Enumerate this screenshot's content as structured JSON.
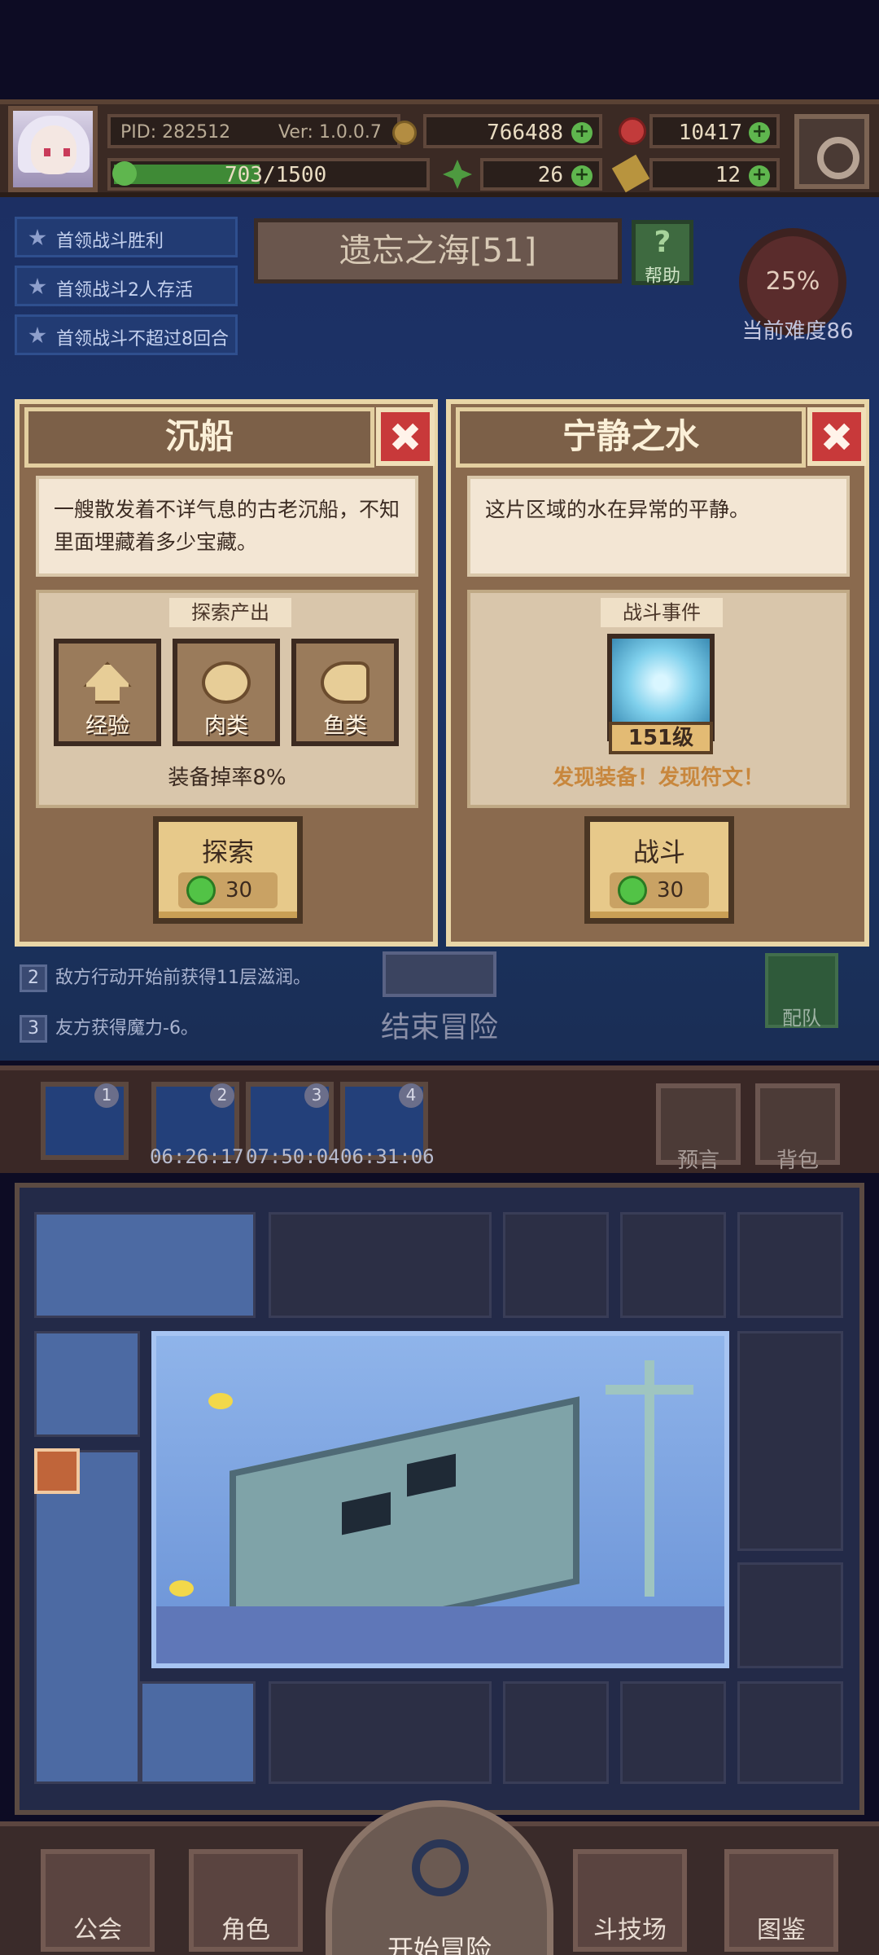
{
  "header": {
    "pid": "PID: 282512",
    "version": "Ver: 1.0.0.7",
    "gold": "766488",
    "gems": "10417",
    "xp_text": "703/1500",
    "xp_progress": 0.47,
    "clover": "26",
    "hammer": "12"
  },
  "quests": [
    {
      "label": "首领战斗胜利"
    },
    {
      "label": "首领战斗2人存活"
    },
    {
      "label": "首领战斗不超过8回合"
    }
  ],
  "zone": {
    "title": "遗忘之海[51]",
    "help": "帮助",
    "help_glyph": "?",
    "difficulty_pct": "25%",
    "difficulty_label": "当前难度86"
  },
  "cards": {
    "left": {
      "title": "沉船",
      "desc": "一艘散发着不详气息的古老沉船，不知里面埋藏着多少宝藏。",
      "panel_title": "探索产出",
      "outputs": [
        {
          "label": "经验"
        },
        {
          "label": "肉类"
        },
        {
          "label": "鱼类"
        }
      ],
      "drop_rate": "装备掉率8%",
      "button": {
        "label": "探索",
        "cost": "30"
      }
    },
    "right": {
      "title": "宁静之水",
      "desc": "这片区域的水在异常的平静。",
      "panel_title": "战斗事件",
      "monster_level": "151级",
      "event_text": "发现装备！发现符文！",
      "button": {
        "label": "战斗",
        "cost": "30"
      }
    }
  },
  "rules": [
    {
      "num": "2",
      "text": "敌方行动开始前获得11层滋润。"
    },
    {
      "num": "3",
      "text": "友方获得魔力-6。"
    }
  ],
  "end_adventure": "结束冒险",
  "team": "配队",
  "slots": [
    {
      "num": "1",
      "timer": ""
    },
    {
      "num": "2",
      "timer": "06:26:17"
    },
    {
      "num": "3",
      "timer": "07:50:04"
    },
    {
      "num": "4",
      "timer": "06:31:06"
    }
  ],
  "side_buttons": {
    "prophecy": "预言",
    "bag": "背包"
  },
  "nav": {
    "guild": "公会",
    "character": "角色",
    "start": "开始冒险",
    "arena": "斗技场",
    "codex": "图鉴"
  },
  "colors": {
    "accent_red": "#c8393a",
    "gold_button": "#e7c98a",
    "gem_green": "#52c346",
    "event_orange": "#c8873d"
  }
}
